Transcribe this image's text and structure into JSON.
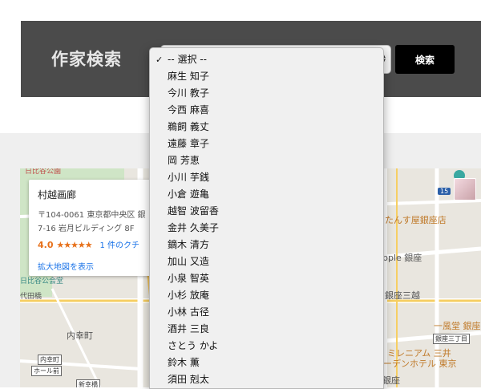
{
  "search": {
    "title": "作家検索",
    "button_label": "検索",
    "selected": "-- 選択 --"
  },
  "options": [
    "-- 選択 --",
    "麻生 知子",
    "今川 教子",
    "今西 麻喜",
    "鵜飼 義丈",
    "遠藤 章子",
    "岡 芳恵",
    "小川 芋銭",
    "小倉 遊亀",
    "越智 波留香",
    "金井 久美子",
    "鏑木 清方",
    "加山 又造",
    "小泉 智英",
    "小杉 放庵",
    "小林 古径",
    "酒井 三良",
    "さとう かよ",
    "鈴木 薫",
    "須田 剋太"
  ],
  "map": {
    "place_name": "村越画廊",
    "address_line1": "〒104-0061 東京都中央区 銀",
    "address_line2": "7-16 岩月ビルディング 8F",
    "rating": "4.0",
    "stars": "★★★★★",
    "reviews": "1 件のクチ",
    "view_larger": "拡大地図を表示",
    "labels": {
      "top_left": "日比谷公園",
      "hibiya_hall": "日比谷公会堂",
      "daimyo": "代田橋",
      "uchisaiwai": "内幸町",
      "shinbashi_station": "内幸町",
      "hall_mae": "ホール前",
      "shinbashi": "新幸橋",
      "tansu": "たんす屋銀座店",
      "apple": "pple 銀座",
      "ginza_mitsukoshi": "銀座三越",
      "ippudo": "一風堂 銀座",
      "ginza_station": "銀座三丁目",
      "millennium1": "ミレニアム 三井",
      "millennium2": "ーデンホテル 東京",
      "ginza_bottom": "銀座",
      "route": "15"
    }
  },
  "colors": {
    "searchbar_bg": "#4b4b4b",
    "button_bg": "#000000",
    "rating": "#e7711b",
    "link": "#1a73e8"
  }
}
